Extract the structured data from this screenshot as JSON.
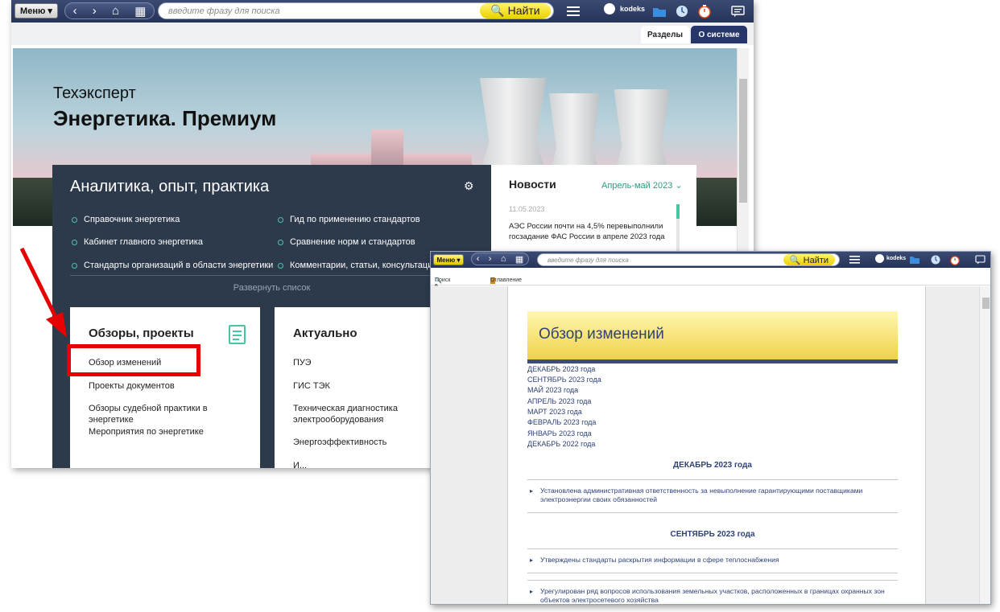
{
  "window_main": {
    "toolbar": {
      "menu_label": "Меню ▾",
      "nav_buttons": [
        "‹",
        "›",
        "⌂",
        "▦"
      ],
      "search_placeholder": "введите фразу для поиска",
      "find_label": "🔍 Найти",
      "user_name": "kodeks"
    },
    "tabs": [
      "Разделы",
      "О системе"
    ],
    "hero": {
      "brand_line": "Техэксперт",
      "product_name": "Энергетика. Премиум"
    },
    "analytics": {
      "title": "Аналитика, опыт, практика",
      "links_left": [
        "Справочник энергетика",
        "Кабинет главного энергетика",
        "Стандарты организаций в области энергетики"
      ],
      "links_right": [
        "Гид по применению стандартов",
        "Сравнение норм и стандартов",
        "Комментарии, статьи, консультации"
      ],
      "expand_label": "Развернуть список"
    },
    "card_reviews": {
      "title": "Обзоры, проекты",
      "items": [
        "Обзор изменений",
        "Проекты документов",
        "Обзоры судебной практики в энергетике",
        "Мероприятия по энергетике"
      ]
    },
    "card_current": {
      "title": "Актуально",
      "items": [
        "ПУЭ",
        "ГИС ТЭК",
        "Техническая диагностика электрооборудования",
        "Энергоэффективность",
        "И..."
      ]
    },
    "news": {
      "title": "Новости",
      "period": "Апрель-май 2023",
      "date": "11.05.2023",
      "text": "АЭС России почти на 4,5% перевыполнили госзадание ФАС России в апреле 2023 года"
    }
  },
  "window_doc": {
    "toolbar": {
      "menu_label": "Меню ▾",
      "nav_buttons": [
        "‹",
        "›",
        "⌂",
        "▦"
      ],
      "search_placeholder": "введите фразу для поиска",
      "find_label": "🔍 Найти",
      "user_name": "kodeks"
    },
    "subbar": {
      "search_in_text": "Поиск в тексте",
      "contents": "Оглавление"
    },
    "document": {
      "title": "Обзор изменений",
      "months": [
        "ДЕКАБРЬ 2023 года",
        "СЕНТЯБРЬ 2023 года",
        "МАЙ 2023 года",
        "АПРЕЛЬ 2023 года",
        "МАРТ 2023 года",
        "ФЕВРАЛЬ 2023 года",
        "ЯНВАРЬ 2023 года",
        "ДЕКАБРЬ 2022 года"
      ],
      "section1_title": "ДЕКАБРЬ 2023 года",
      "section1_item": "Установлена административная ответственность за невыполнение гарантирующими поставщиками электроэнергии своих обязанностей",
      "section2_title": "СЕНТЯБРЬ 2023 года",
      "section2_item1": "Утверждены стандарты раскрытия информации в сфере теплоснабжения",
      "section2_item2": "Урегулирован ряд вопросов использования земельных участков, расположенных в границах охранных зон объектов электросетевого хозяйства"
    }
  },
  "colors": {
    "toolbar": "#26345a",
    "find_button": "#ead100",
    "analytics_bg": "#2d3a4c",
    "accent": "#46c7a4",
    "highlight": "#e60000",
    "doc_link": "#2f4277"
  }
}
